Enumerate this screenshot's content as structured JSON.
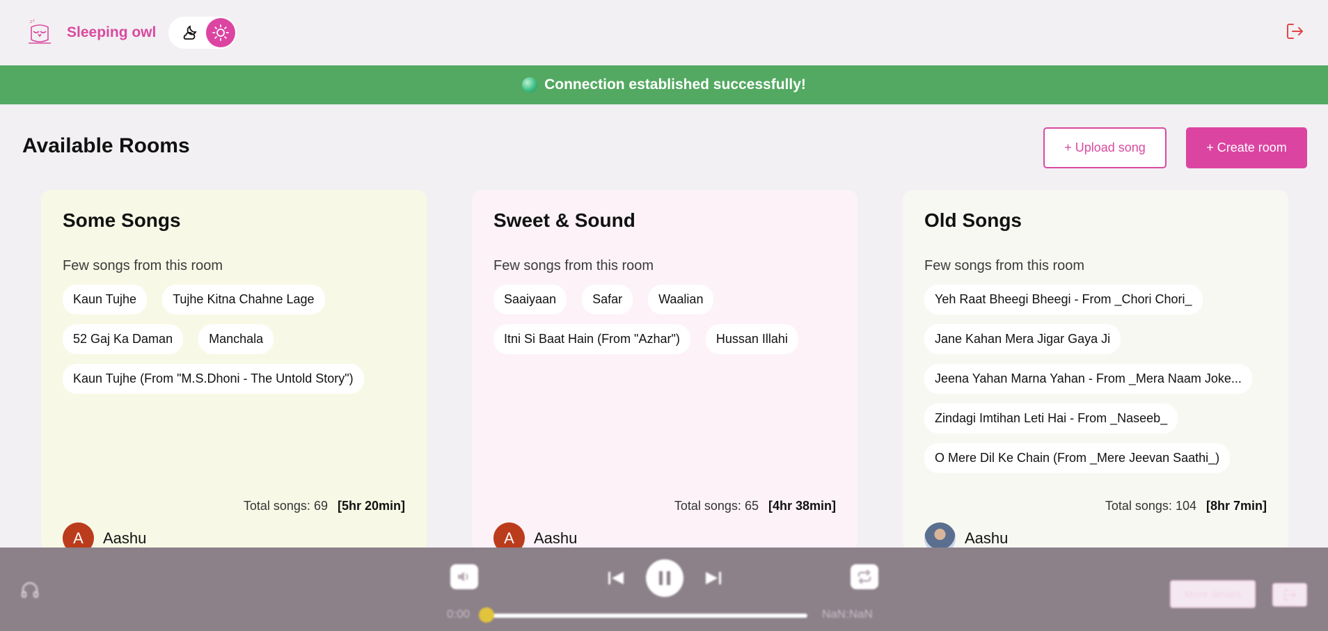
{
  "header": {
    "app_title": "Sleeping owl",
    "logo_icon": "owl-icon",
    "theme_icons": [
      "cloud-moon-icon",
      "sun-icon"
    ],
    "logout_icon": "logout-icon",
    "accent": "#dc44a2"
  },
  "banner": {
    "message": "Connection established successfully!",
    "color": "#53a961"
  },
  "rooms": {
    "title": "Available Rooms",
    "upload_label": "+ Upload song",
    "create_label": "+ Create room",
    "cards": [
      {
        "name": "Some Songs",
        "subtitle": "Few songs from this room",
        "songs": [
          "Kaun Tujhe",
          "Tujhe Kitna Chahne Lage",
          "52 Gaj Ka Daman",
          "Manchala",
          "Kaun Tujhe (From \"M.S.Dhoni - The Untold Story\")"
        ],
        "total_label": "Total songs:",
        "total": "69",
        "duration": "[5hr 20min]",
        "owner": "Aashu",
        "avatar_letter": "A",
        "bg": "#f7f9e6"
      },
      {
        "name": "Sweet & Sound",
        "subtitle": "Few songs from this room",
        "songs": [
          "Saaiyaan",
          "Safar",
          "Waalian",
          "Itni Si Baat Hain (From \"Azhar\")",
          "Hussan Illahi"
        ],
        "total_label": "Total songs:",
        "total": "65",
        "duration": "[4hr 38min]",
        "owner": "Aashu",
        "avatar_letter": "A",
        "bg": "#fcf2f7"
      },
      {
        "name": "Old Songs",
        "subtitle": "Few songs from this room",
        "songs": [
          "Yeh Raat Bheegi Bheegi - From _Chori Chori_",
          "Jane Kahan Mera Jigar Gaya Ji",
          "Jeena Yahan Marna Yahan - From _Mera Naam Joke...",
          "Zindagi Imtihan Leti Hai - From _Naseeb_",
          "O Mere Dil Ke Chain (From _Mere Jeevan Saathi_)"
        ],
        "total_label": "Total songs:",
        "total": "104",
        "duration": "[8hr 7min]",
        "owner": "Aashu",
        "avatar_letter": "",
        "bg": "#f8f8f3"
      }
    ]
  },
  "player": {
    "current_time": "0:00",
    "total_time": "NaN:NaN",
    "progress": 0,
    "more_details_label": "More details",
    "icons": [
      "headphones-icon",
      "volume-icon",
      "previous-icon",
      "pause-icon",
      "next-icon",
      "repeat-icon",
      "exit-icon"
    ]
  }
}
